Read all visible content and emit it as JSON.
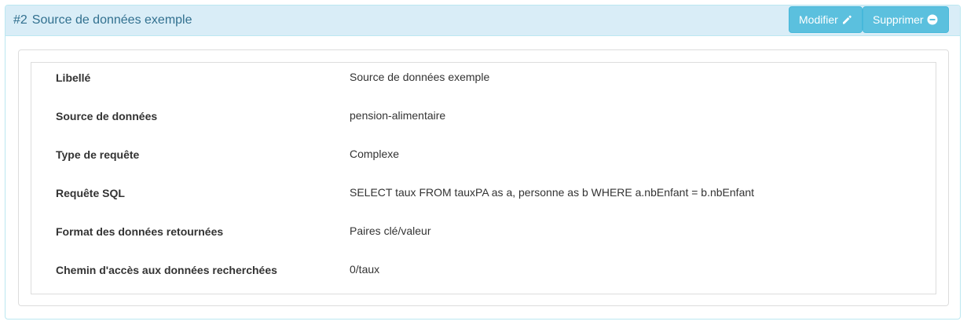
{
  "header": {
    "number": "#2",
    "title": "Source de données exemple",
    "edit_label": "Modifier",
    "delete_label": "Supprimer"
  },
  "colors": {
    "heading_bg": "#d9edf7",
    "heading_text": "#31708f",
    "button_bg": "#5bc0de"
  },
  "fields": [
    {
      "label": "Libellé",
      "value": "Source de données exemple"
    },
    {
      "label": "Source de données",
      "value": "pension-alimentaire"
    },
    {
      "label": "Type de requête",
      "value": "Complexe"
    },
    {
      "label": "Requête SQL",
      "value": "SELECT taux FROM tauxPA as a, personne as b WHERE a.nbEnfant = b.nbEnfant"
    },
    {
      "label": "Format des données retournées",
      "value": "Paires clé/valeur"
    },
    {
      "label": "Chemin d'accès aux données recherchées",
      "value": "0/taux"
    }
  ]
}
